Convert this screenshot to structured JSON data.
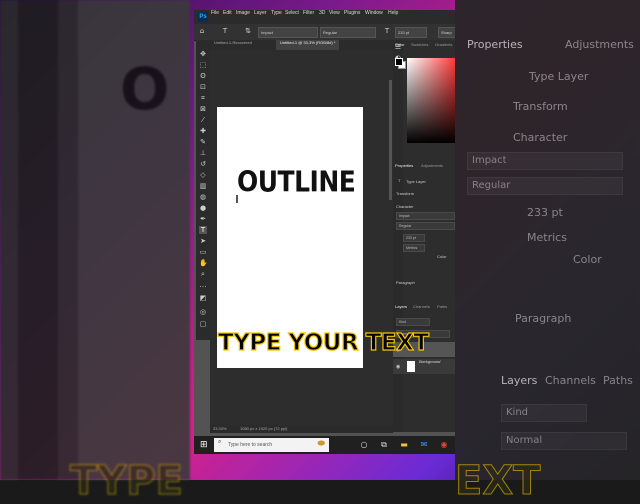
{
  "app": {
    "logo": "Ps",
    "menus": [
      "File",
      "Edit",
      "Image",
      "Layer",
      "Type",
      "Select",
      "Filter",
      "3D",
      "View",
      "Plugins",
      "Window",
      "Help"
    ]
  },
  "options": {
    "font_family": "Impact",
    "font_style": "Regular",
    "font_size": "233 pt",
    "antialias": "Sharp"
  },
  "tabs": [
    {
      "label": "Untitled-1-Recovered"
    },
    {
      "label": "Untitled-1 @ 33.3% (RGB/8#) *"
    }
  ],
  "canvas": {
    "headline": "OUTLINE",
    "zoom": "33.33%",
    "doc_info": "1080 px x 1920 px (72 ppi)"
  },
  "panels": {
    "color_tabs": [
      "Color",
      "Swatches",
      "Gradients"
    ],
    "props_tabs": [
      "Properties",
      "Adjustments"
    ],
    "type_layer": "Type Layer",
    "transform": "Transform",
    "character": "Character",
    "font": "Impact",
    "style": "Regular",
    "size": "233 pt",
    "kerning": "Metrics",
    "color_label": "Color",
    "paragraph": "Paragraph",
    "layers_tabs": [
      "Layers",
      "Channels",
      "Paths"
    ],
    "search_placeholder": "Kind",
    "blend": "Normal",
    "layers": [
      {
        "name": "Background",
        "selected": false
      }
    ]
  },
  "taskbar": {
    "search_placeholder": "Type here to search"
  },
  "overlay": {
    "caption": "TYPE YOUR TEXT"
  },
  "bg_right": {
    "properties": "Properties",
    "adjustments": "Adjustments",
    "type_layer": "Type Layer",
    "transform": "Transform",
    "character": "Character",
    "font": "Impact",
    "style": "Regular",
    "size": "233 pt",
    "kerning": "Metrics",
    "color": "Color",
    "paragraph": "Paragraph",
    "layers": "Layers",
    "channels": "Channels",
    "paths": "Paths",
    "kind": "Kind",
    "normal": "Normal"
  }
}
